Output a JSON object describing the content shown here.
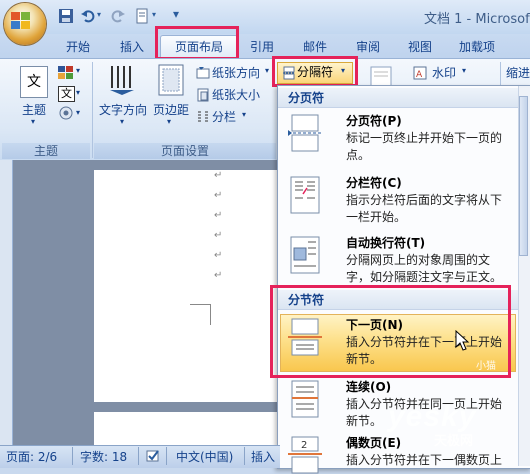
{
  "window": {
    "title": "文档 1 - Microsof"
  },
  "tabs": [
    "开始",
    "插入",
    "页面布局",
    "引用",
    "邮件",
    "审阅",
    "视图",
    "加载项"
  ],
  "ribbon": {
    "theme_label": "主题",
    "text_dir": "文字方向",
    "margins": "页边距",
    "orientation": "纸张方向",
    "size": "纸张大小",
    "columns": "分栏",
    "breaks": "分隔符",
    "watermark": "水印",
    "indent": "缩进",
    "group_theme": "主题",
    "group_page_setup": "页面设置",
    "doc_icon_text": "文"
  },
  "menu": {
    "page_breaks_header": "分页符",
    "section_breaks_header": "分节符",
    "items": [
      {
        "title": "分页符(P)",
        "desc": "标记一页终止并开始下一页的点。"
      },
      {
        "title": "分栏符(C)",
        "desc": "指示分栏符后面的文字将从下一栏开始。"
      },
      {
        "title": "自动换行符(T)",
        "desc": "分隔网页上的对象周围的文字，如分隔题注文字与正文。"
      },
      {
        "title": "下一页(N)",
        "desc": "插入分节符并在下一页上开始新节。"
      },
      {
        "title": "连续(O)",
        "desc": "插入分节符并在同一页上开始新节。"
      },
      {
        "title": "偶数页(E)",
        "desc": "插入分节符并在下一偶数页上"
      }
    ]
  },
  "status": {
    "page": "页面: 2/6",
    "words": "字数: 18",
    "lang": "中文(中国)",
    "insert": "插入"
  },
  "watermark": {
    "main": "yesky",
    "sub": "天极网",
    "small": "小猫"
  },
  "colors": {
    "accent": "#e5225a",
    "highlight": "#fde08a"
  }
}
